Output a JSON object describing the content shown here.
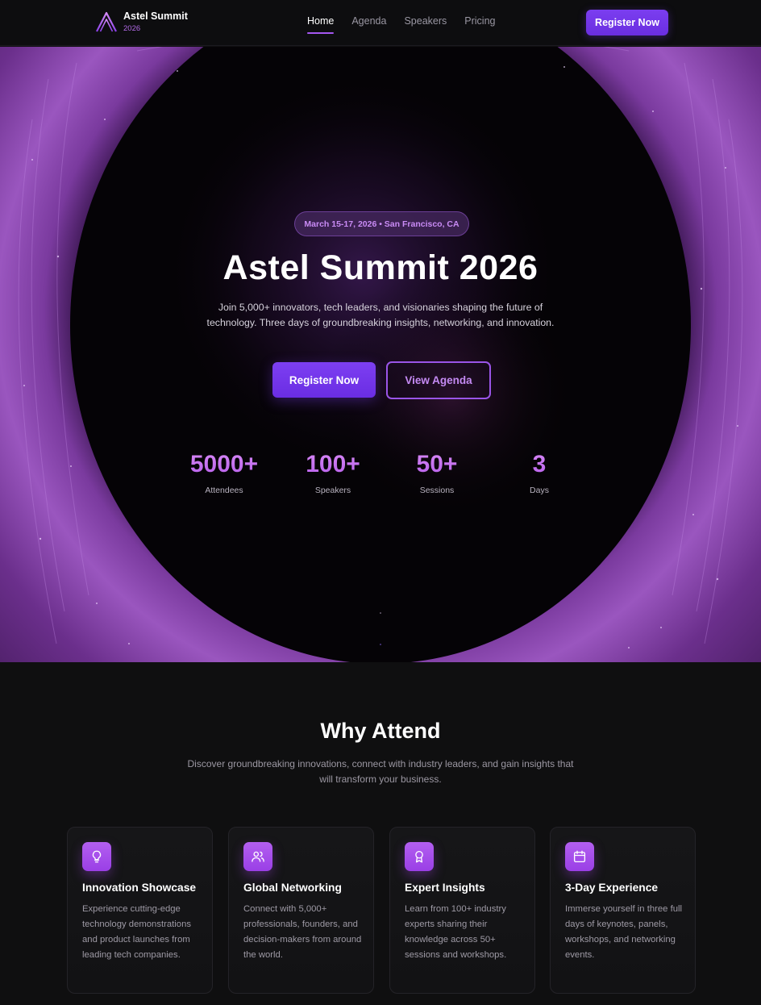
{
  "nav": {
    "brand_title": "Astel Summit",
    "brand_year": "2026",
    "links": [
      {
        "label": "Home",
        "active": true
      },
      {
        "label": "Agenda",
        "active": false
      },
      {
        "label": "Speakers",
        "active": false
      },
      {
        "label": "Pricing",
        "active": false
      }
    ],
    "cta_label": "Register Now"
  },
  "hero": {
    "badge": "March 15-17, 2026 • San Francisco, CA",
    "title": "Astel Summit 2026",
    "description": "Join 5,000+ innovators, tech leaders, and visionaries shaping the future of technology. Three days of groundbreaking insights, networking, and innovation.",
    "primary_button": "Register Now",
    "secondary_button": "View Agenda",
    "stats": [
      {
        "value": "5000+",
        "label": "Attendees"
      },
      {
        "value": "100+",
        "label": "Speakers"
      },
      {
        "value": "50+",
        "label": "Sessions"
      },
      {
        "value": "3",
        "label": "Days"
      }
    ]
  },
  "why": {
    "title": "Why Attend",
    "description": "Discover groundbreaking innovations, connect with industry leaders, and gain insights that will transform your business.",
    "cards": [
      {
        "icon": "lightbulb-icon",
        "title": "Innovation Showcase",
        "text": "Experience cutting-edge technology demonstrations and product launches from leading tech companies."
      },
      {
        "icon": "users-icon",
        "title": "Global Networking",
        "text": "Connect with 5,000+ professionals, founders, and decision-makers from around the world."
      },
      {
        "icon": "award-icon",
        "title": "Expert Insights",
        "text": "Learn from 100+ industry experts sharing their knowledge across 50+ sessions and workshops."
      },
      {
        "icon": "calendar-icon",
        "title": "3-Day Experience",
        "text": "Immerse yourself in three full days of keynotes, panels, workshops, and networking events."
      }
    ]
  },
  "colors": {
    "accent": "#7b3ef0",
    "accent_light": "#c98bf5",
    "background": "#0f0f10"
  }
}
